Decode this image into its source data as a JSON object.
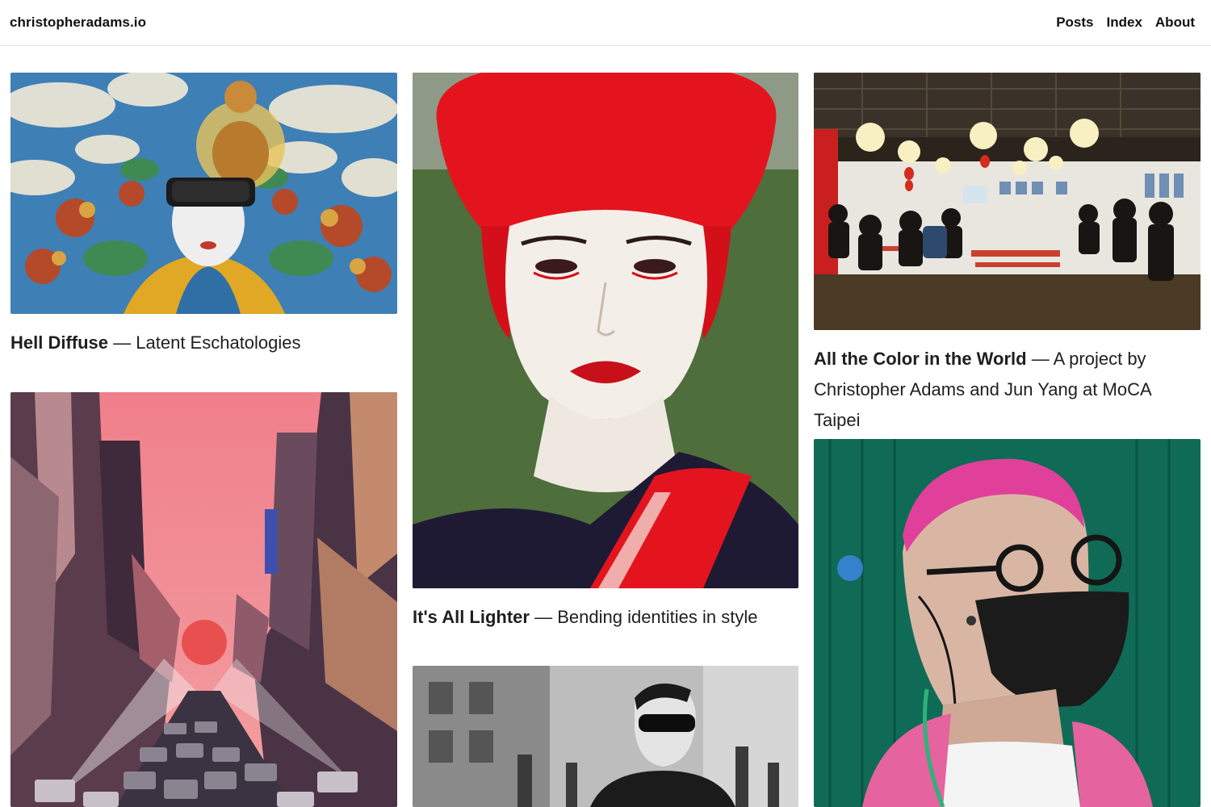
{
  "header": {
    "site_title": "christopheradams.io",
    "nav": [
      {
        "label": "Posts"
      },
      {
        "label": "Index"
      },
      {
        "label": "About"
      }
    ]
  },
  "posts": [
    {
      "title": "Hell Diffuse",
      "separator": " — ",
      "subtitle": "Latent Eschatologies",
      "image": "vr-buddha-painting"
    },
    {
      "title": "It's All Lighter",
      "separator": " — ",
      "subtitle": "Bending identities in style",
      "image": "red-hair-portrait"
    },
    {
      "title": "All the Color in the World",
      "separator": " — ",
      "subtitle": "A project by Christopher Adams and Jun Yang at MoCA Taipei",
      "image": "gallery-event-lanterns"
    },
    {
      "title": "",
      "separator": "",
      "subtitle": "",
      "image": "abstract-pink-city-street"
    },
    {
      "title": "",
      "separator": "",
      "subtitle": "",
      "image": "bw-man-sunglasses-street"
    },
    {
      "title": "",
      "separator": "",
      "subtitle": "",
      "image": "pink-hair-masked-man"
    }
  ],
  "colors": {
    "text": "#1a1a1a",
    "border": "#e2e2e2",
    "accent_red": "#e0141e",
    "pink": "#e0508c"
  }
}
